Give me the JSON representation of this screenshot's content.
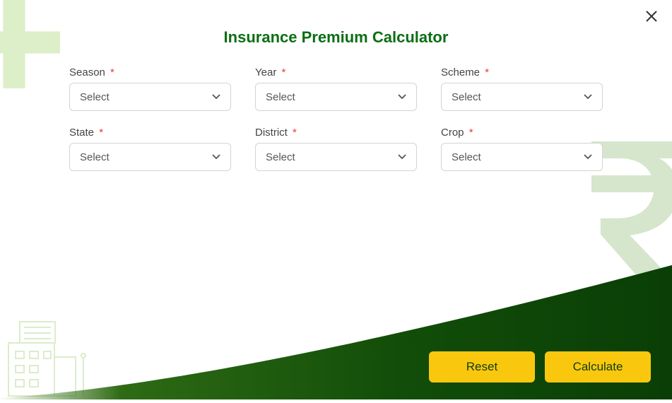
{
  "title": "Insurance Premium Calculator",
  "form": {
    "select_placeholder": "Select",
    "required_mark": "*",
    "fields": {
      "season": {
        "label": "Season",
        "value": "Select"
      },
      "year": {
        "label": "Year",
        "value": "Select"
      },
      "scheme": {
        "label": "Scheme",
        "value": "Select"
      },
      "state": {
        "label": "State",
        "value": "Select"
      },
      "district": {
        "label": "District",
        "value": "Select"
      },
      "crop": {
        "label": "Crop",
        "value": "Select"
      }
    }
  },
  "actions": {
    "reset": "Reset",
    "calculate": "Calculate"
  }
}
